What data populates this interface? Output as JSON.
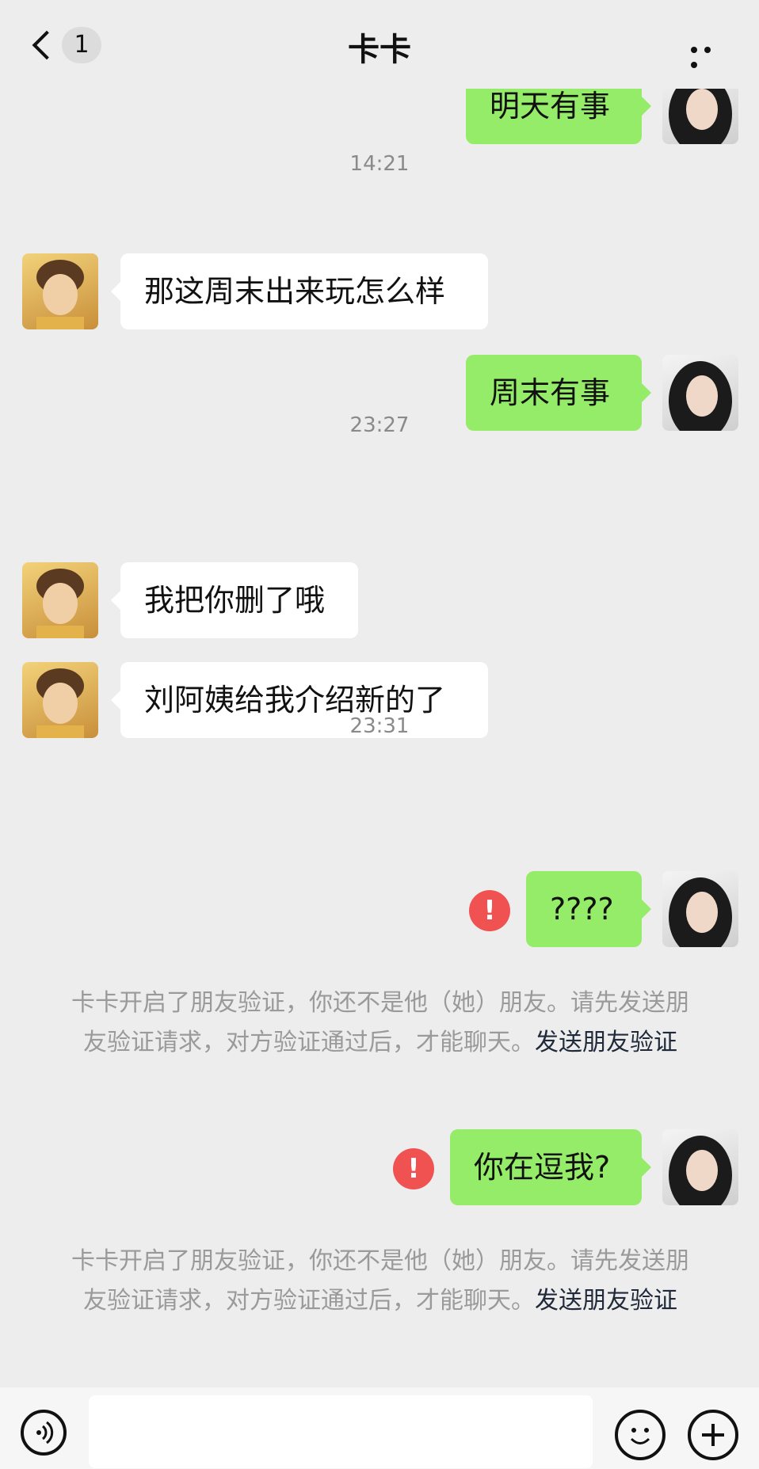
{
  "header": {
    "title": "卡卡",
    "unread_count": "1"
  },
  "messages": [
    {
      "side": "right",
      "text": "明天有事",
      "partial": true
    },
    {
      "type": "time",
      "text": "14:21"
    },
    {
      "side": "left",
      "text": "那这周末出来玩怎么样"
    },
    {
      "side": "right",
      "text": "周末有事"
    },
    {
      "type": "time",
      "text": "23:27"
    },
    {
      "side": "left",
      "text": "我把你删了哦"
    },
    {
      "side": "left",
      "text": "刘阿姨给我介绍新的了"
    },
    {
      "type": "time",
      "text": "23:31"
    },
    {
      "side": "right",
      "text": "????",
      "failed": true
    },
    {
      "type": "system",
      "text": "卡卡开启了朋友验证，你还不是他（她）朋友。请先发送朋友验证请求，对方验证通过后，才能聊天。",
      "link": "发送朋友验证"
    },
    {
      "side": "right",
      "text": "你在逗我?",
      "failed": true
    },
    {
      "type": "system",
      "text": "卡卡开启了朋友验证，你还不是他（她）朋友。请先发送朋友验证请求，对方验证通过后，才能聊天。",
      "link": "发送朋友验证"
    }
  ],
  "colors": {
    "background": "#ededed",
    "bubble_self": "#95ec69",
    "bubble_other": "#ffffff",
    "error": "#f05151",
    "timestamp_text": "#8a8a8a"
  },
  "icons": {
    "back": "chevron-left-icon",
    "more": "more-dots-icon",
    "error": "exclamation-icon",
    "voice": "voice-icon",
    "emoji": "emoji-icon",
    "plus": "plus-icon"
  }
}
